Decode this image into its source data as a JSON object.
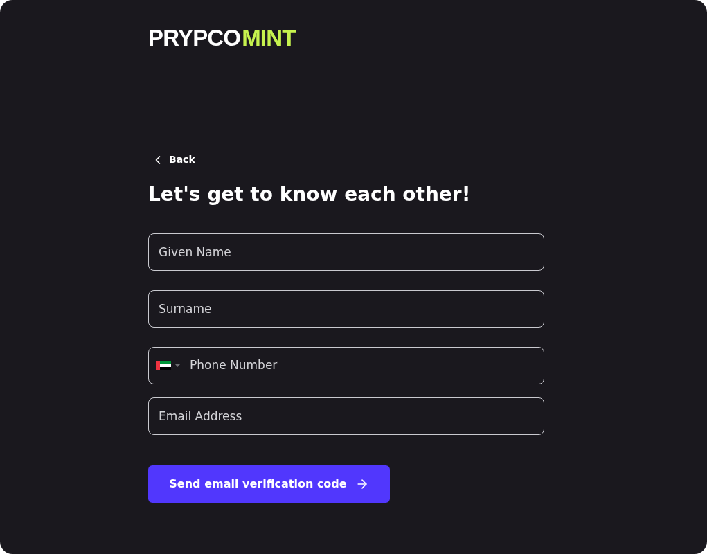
{
  "logo": {
    "primary": "PRYPCO",
    "accent": "MINT"
  },
  "back": {
    "label": "Back"
  },
  "heading": "Let's get to know each other!",
  "fields": [
    {
      "kind": "text",
      "placeholder": "Given Name"
    },
    {
      "kind": "text",
      "placeholder": "Surname"
    },
    {
      "kind": "phone",
      "placeholder": "Phone Number"
    },
    {
      "kind": "text",
      "placeholder": "Email Address"
    }
  ],
  "submit": {
    "label": "Send email verification code"
  }
}
